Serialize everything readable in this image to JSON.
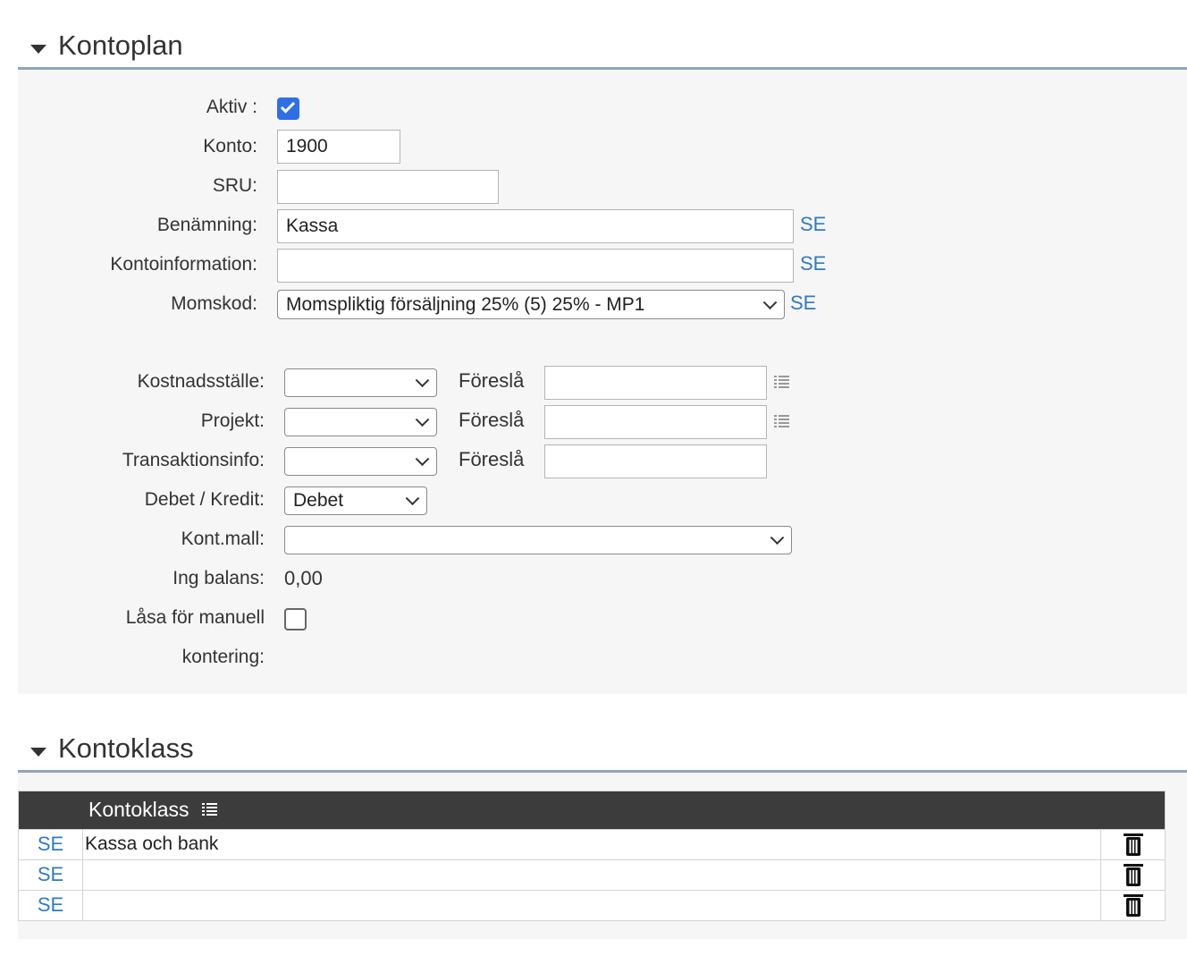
{
  "kontoplan": {
    "title": "Kontoplan",
    "aktiv_label": "Aktiv :",
    "aktiv_checked": true,
    "konto_label": "Konto:",
    "konto_value": "1900",
    "sru_label": "SRU:",
    "sru_value": "",
    "benamning_label": "Benämning:",
    "benamning_value": "Kassa",
    "kontoinformation_label": "Kontoinformation:",
    "kontoinformation_value": "",
    "momskod_label": "Momskod:",
    "momskod_value": "Momspliktig försäljning 25% (5) 25% - MP1",
    "se_link": "SE",
    "kostnadsstalle_label": "Kostnadsställe:",
    "kostnadsstalle_value": "",
    "projekt_label": "Projekt:",
    "projekt_value": "",
    "transaktionsinfo_label": "Transaktionsinfo:",
    "transaktionsinfo_value": "",
    "foresla_label": "Föreslå",
    "debet_kredit_label": "Debet / Kredit:",
    "debet_kredit_value": "Debet",
    "kontmall_label": "Kont.mall:",
    "kontmall_value": "",
    "ing_balans_label": "Ing balans:",
    "ing_balans_value": "0,00",
    "lasa_label_line1": "Låsa för manuell",
    "lasa_label_line2": "kontering:",
    "lasa_checked": false
  },
  "kontoklass": {
    "title": "Kontoklass",
    "column_header": "Kontoklass",
    "rows": [
      {
        "link": "SE",
        "value": "Kassa och bank"
      },
      {
        "link": "SE",
        "value": ""
      },
      {
        "link": "SE",
        "value": ""
      }
    ]
  },
  "colors": {
    "link": "#2f7bc2",
    "header_rule": "#8fa5bd",
    "checkbox_checked": "#2f6fe4",
    "table_header_bg": "#3c3c3c"
  },
  "icons": {
    "section_toggle": "caret-down-icon",
    "column_menu": "list-icon",
    "row_delete": "trash-icon"
  }
}
